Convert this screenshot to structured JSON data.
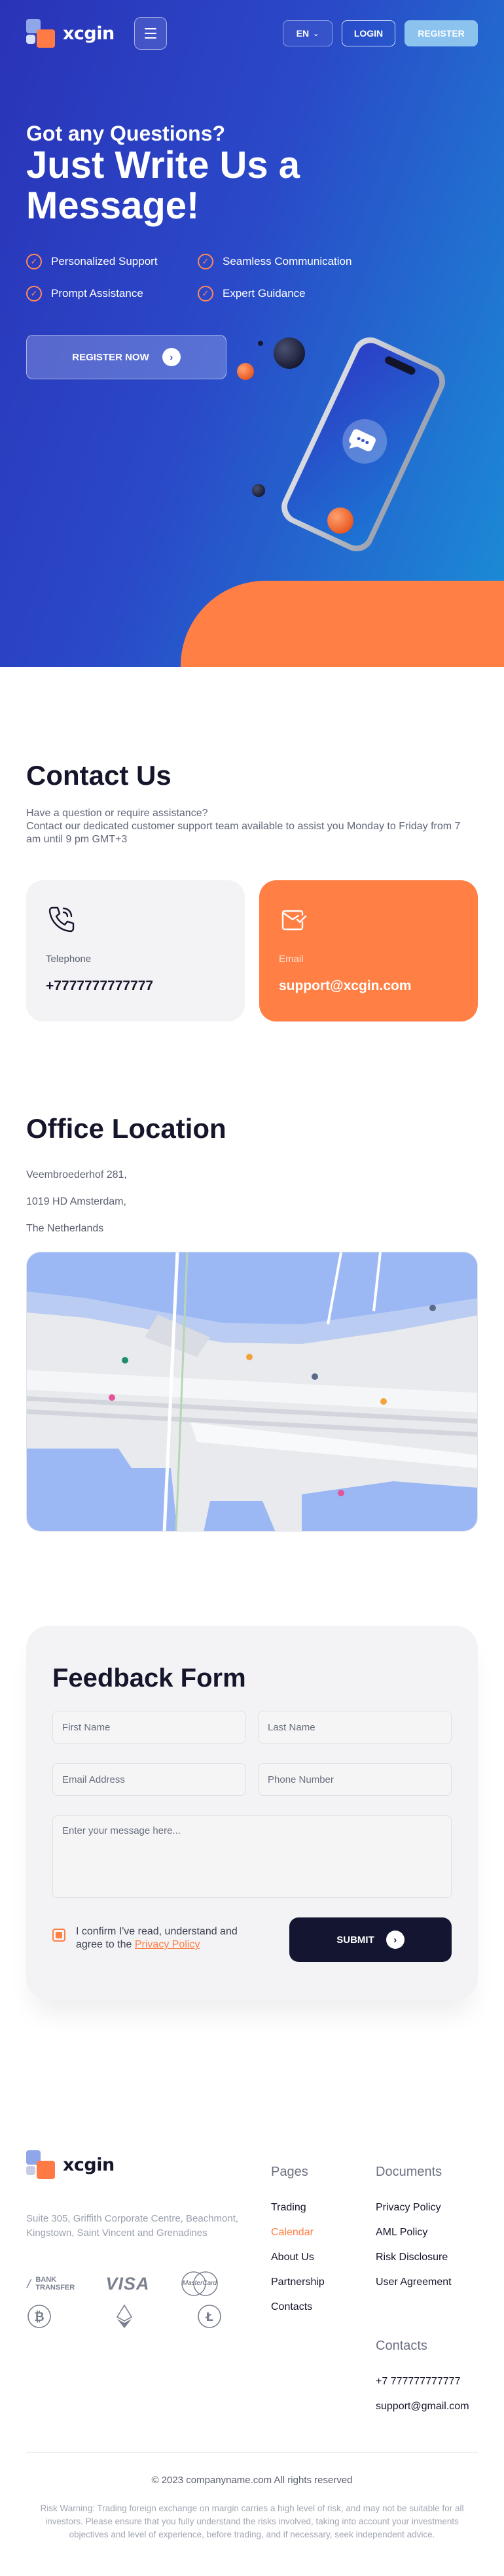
{
  "brand": {
    "name": "xcgin",
    "accent": "#ff7f45",
    "primary": "#2a33b8"
  },
  "header": {
    "lang": "EN",
    "login": "LOGIN",
    "register": "REGISTER"
  },
  "hero": {
    "subtitle": "Got any Questions?",
    "title": "Just Write Us a Message!",
    "features": [
      "Personalized Support",
      "Seamless Communication",
      "Prompt Assistance",
      "Expert Guidance"
    ],
    "cta": "REGISTER NOW"
  },
  "contact": {
    "title": "Contact Us",
    "intro1": "Have a question or require assistance?",
    "intro2": "Contact our dedicated customer support team available to assist you Monday to Friday from 7 am until 9 pm GMT+3",
    "telephone_label": "Telephone",
    "telephone_value": "+7777777777777",
    "email_label": "Email",
    "email_value": "support@xcgin.com"
  },
  "office": {
    "title": "Office Location",
    "line1": "Veembroederhof 281,",
    "line2": "1019 HD Amsterdam,",
    "line3": "The Netherlands"
  },
  "feedback": {
    "title": "Feedback Form",
    "first_name": "First Name",
    "last_name": "Last Name",
    "email": "Email Address",
    "phone": "Phone Number",
    "message": "Enter your message here...",
    "consent": "I confirm I've read, understand and agree to the",
    "privacy": "Privacy Policy",
    "submit": "SUBMIT"
  },
  "footer": {
    "address": "Suite 305, Griffith Corporate Centre, Beachmont, Kingstown, Saint Vincent and Grenadines",
    "pay_bank": "BANK TRANSFER",
    "pay_visa": "VISA",
    "pay_mc": "MasterCard",
    "pages_title": "Pages",
    "pages": [
      "Trading",
      "Calendar",
      "About Us",
      "Partnership",
      "Contacts"
    ],
    "docs_title": "Documents",
    "docs": [
      "Privacy Policy",
      "AML Policy",
      "Risk Disclosure",
      "User Agreement"
    ],
    "contacts_title": "Contacts",
    "contact_phone": "+7 777777777777",
    "contact_email": "support@gmail.com",
    "copyright": "© 2023 companyname.com All rights reserved",
    "risk": "Risk Warning: Trading foreign exchange on margin carries a high level of risk, and may not be suitable for all investors. Please ensure that you fully understand the risks involved, taking into account your investments objectives and level of experience, before trading, and if necessary, seek independent advice."
  }
}
